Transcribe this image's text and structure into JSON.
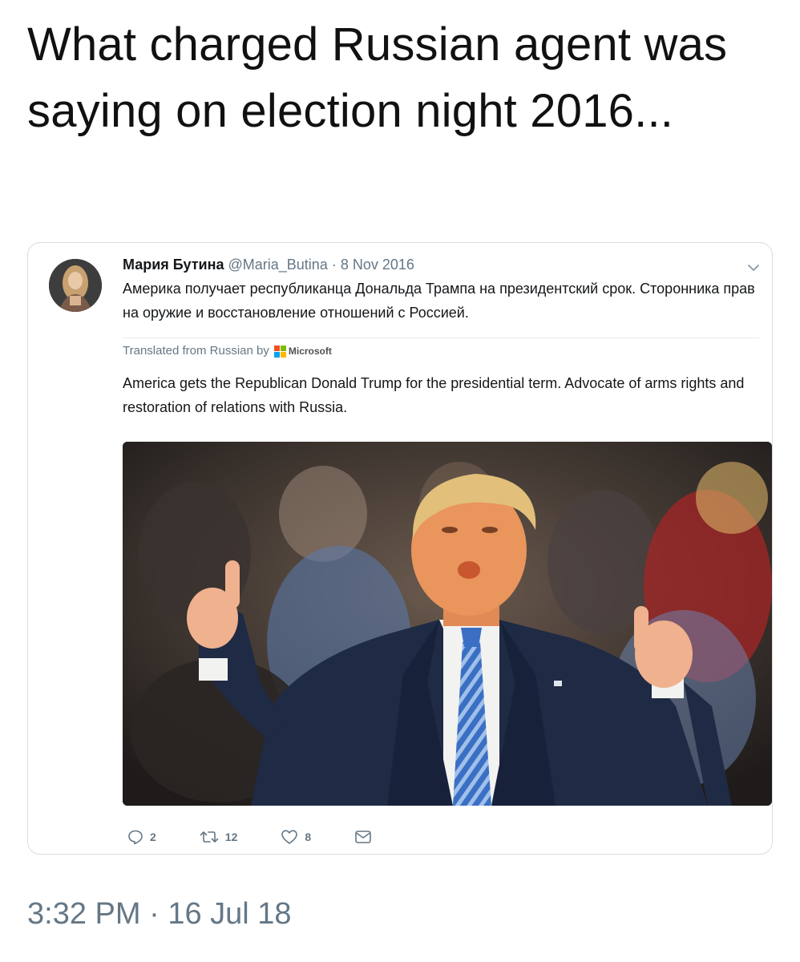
{
  "post": {
    "text": "What charged Russian agent was saying on election night 2016..."
  },
  "quoted_tweet": {
    "display_name": "Мария Бутина",
    "handle": "@Maria_Butina",
    "separator": "·",
    "date": "8 Nov 2016",
    "text": "Америка получает республиканца Дональда Трампа на президентский срок. Сторонника прав на оружие и восстановление отношений с Россией.",
    "translated_label": "Translated from Russian by",
    "translator_name": "Microsoft",
    "translation": "America gets the Republican Donald Trump for the presidential term. Advocate of arms rights and restoration of relations with Russia.",
    "actions": {
      "replies": "2",
      "retweets": "12",
      "likes": "8"
    },
    "icons": [
      "avatar",
      "chevron-down-icon",
      "microsoft-logo-icon",
      "reply-icon",
      "retweet-icon",
      "like-icon",
      "direct-message-icon"
    ]
  },
  "timestamp": {
    "time": "3:32 PM",
    "separator": "·",
    "date": "16 Jul 18"
  },
  "colors": {
    "text_primary": "#14171a",
    "text_secondary": "#657786",
    "card_border": "#d9dde1",
    "microsoft_red": "#f25022",
    "microsoft_green": "#7fba00",
    "microsoft_blue": "#00a4ef",
    "microsoft_yellow": "#ffb900"
  }
}
